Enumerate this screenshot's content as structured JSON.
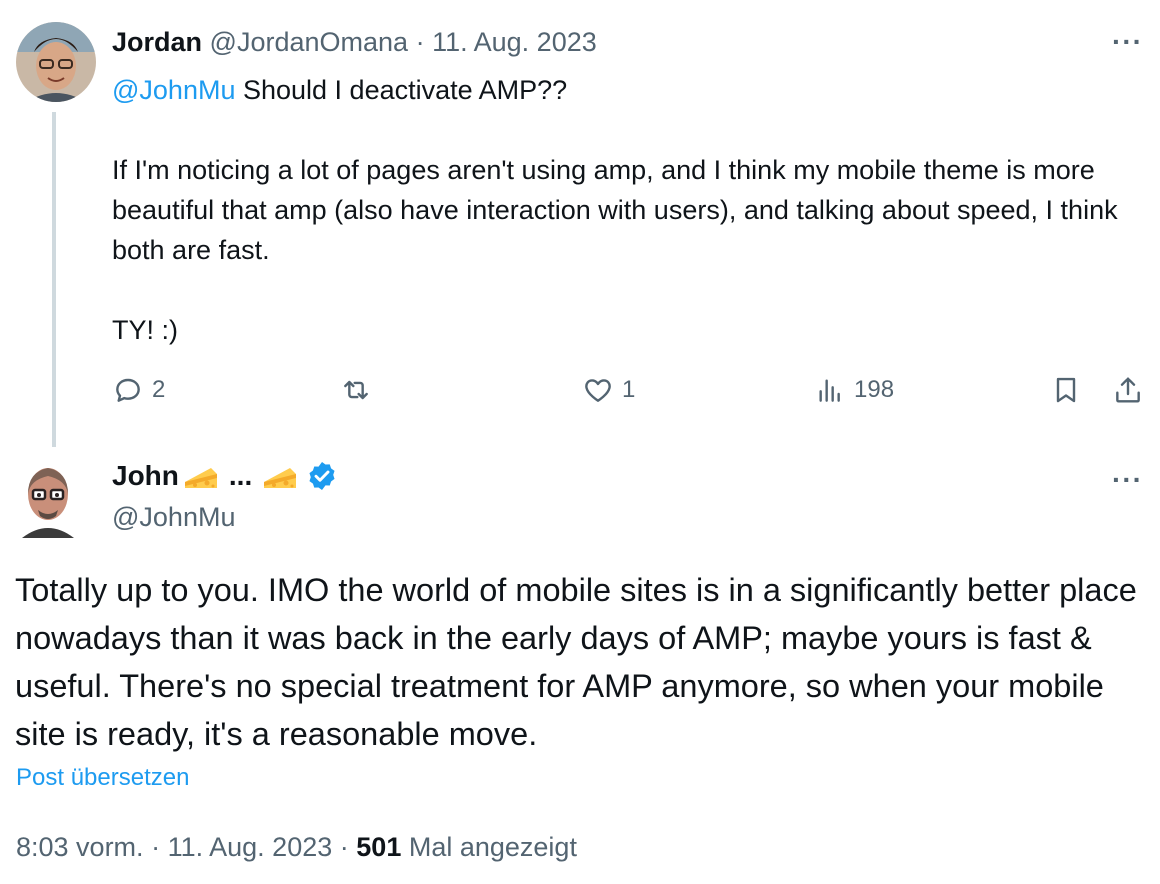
{
  "reply": {
    "author_name": "Jordan",
    "author_handle": "@JordanOmana",
    "separator": "·",
    "date": "11. Aug. 2023",
    "more_label": "···",
    "mention": "@JohnMu",
    "first_line": " Should I deactivate AMP??",
    "paragraph": "If I'm noticing a lot of pages aren't using amp, and I think my mobile theme is more beautiful that amp (also have interaction with users), and talking about speed, I think both are fast.",
    "closing": "TY! :)",
    "actions": {
      "replies": "2",
      "likes": "1",
      "views": "198"
    }
  },
  "main": {
    "author_name": "John",
    "name_ellipsis": "...",
    "author_handle": "@JohnMu",
    "more_label": "···",
    "body": "Totally up to you. IMO the world of mobile sites is in a significantly better place nowadays than it was back in the early days of AMP; maybe yours is fast & useful. There's no special treatment for AMP anymore, so when your mobile site is ready, it's a reasonable move.",
    "translate_label": "Post übersetzen",
    "time": "8:03 vorm.",
    "separator": "·",
    "date": "11. Aug. 2023",
    "separator2": "·",
    "views_count": "501",
    "views_label": " Mal angezeigt"
  },
  "icons": {
    "reply": "reply-icon",
    "retweet": "retweet-icon",
    "like": "heart-icon",
    "views": "views-icon",
    "bookmark": "bookmark-icon",
    "share": "share-icon",
    "verified": "verified-badge-icon",
    "emoji": "cheese-emoji-icon"
  },
  "colors": {
    "accent": "#1d9bf0",
    "muted": "#536471",
    "text": "#0f1419",
    "thread_line": "#cfd9de"
  }
}
